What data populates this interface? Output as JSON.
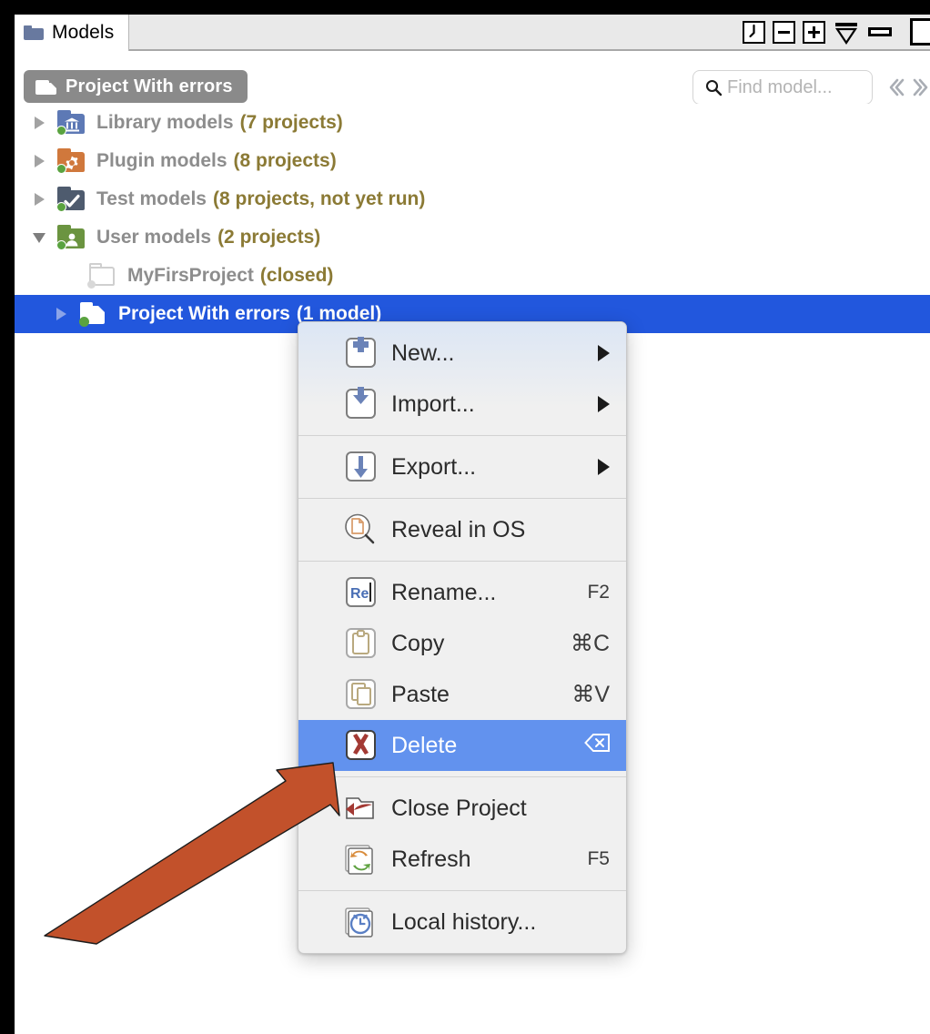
{
  "window": {
    "tab": {
      "label": "Models",
      "icon": "folder-icon"
    },
    "controls": [
      {
        "name": "clock-button",
        "icon": "clock-icon"
      },
      {
        "name": "collapse-all-button",
        "icon": "minus-box-icon"
      },
      {
        "name": "expand-all-button",
        "icon": "plus-box-icon"
      },
      {
        "name": "settings-button",
        "icon": "hourglass-icon"
      },
      {
        "name": "minimize-button",
        "icon": "minimize-icon"
      },
      {
        "name": "maximize-button",
        "icon": "maximize-icon"
      }
    ]
  },
  "toolbar": {
    "breadcrumb": {
      "label": "Project With errors",
      "icon": "folder-icon"
    },
    "search": {
      "placeholder": "Find model...",
      "value": "",
      "icon": "search-icon"
    },
    "nav_prev_icon": "chevron-left-double-icon",
    "nav_next_icon": "chevron-right-double-icon"
  },
  "tree": {
    "rows": [
      {
        "id": "library-models",
        "label": "Library models",
        "count": "(7 projects)",
        "expanded": false,
        "icon": "library-folder-icon",
        "icon_color": "#5d79b5",
        "level": 1,
        "selected": false
      },
      {
        "id": "plugin-models",
        "label": "Plugin models",
        "count": "(8 projects)",
        "expanded": false,
        "icon": "plugin-folder-icon",
        "icon_color": "#d0783c",
        "level": 1,
        "selected": false
      },
      {
        "id": "test-models",
        "label": "Test models",
        "count": "(8 projects, not yet run)",
        "expanded": false,
        "icon": "test-folder-icon",
        "icon_color": "#4e5b6e",
        "level": 1,
        "selected": false
      },
      {
        "id": "user-models",
        "label": "User models",
        "count": "(2 projects)",
        "expanded": true,
        "icon": "user-folder-icon",
        "icon_color": "#6b9440",
        "level": 1,
        "selected": false
      },
      {
        "id": "myfirsproject",
        "label": "MyFirsProject",
        "count": "(closed)",
        "expanded": null,
        "icon": "closed-folder-icon",
        "icon_color": "#cfcfcf",
        "level": 2,
        "selected": false
      },
      {
        "id": "project-with-errors",
        "label": "Project With errors",
        "count": "(1 model)",
        "expanded": false,
        "icon": "open-project-folder-icon",
        "icon_color": "#ffffff",
        "level": 2,
        "selected": true
      }
    ]
  },
  "context_menu": {
    "groups": [
      {
        "items": [
          {
            "id": "new",
            "label": "New...",
            "icon": "new-plus-icon",
            "accel": "",
            "submenu": true,
            "highlighted": false
          },
          {
            "id": "import",
            "label": "Import...",
            "icon": "import-down-arrow-icon",
            "accel": "",
            "submenu": true,
            "highlighted": false
          }
        ]
      },
      {
        "items": [
          {
            "id": "export",
            "label": "Export...",
            "icon": "export-down-arrow-icon",
            "accel": "",
            "submenu": true,
            "highlighted": false
          }
        ]
      },
      {
        "items": [
          {
            "id": "reveal-in-os",
            "label": "Reveal in OS",
            "icon": "reveal-magnifier-icon",
            "accel": "",
            "submenu": false,
            "highlighted": false
          }
        ]
      },
      {
        "items": [
          {
            "id": "rename",
            "label": "Rename...",
            "icon": "rename-re-icon",
            "accel": "F2",
            "submenu": false,
            "highlighted": false
          },
          {
            "id": "copy",
            "label": "Copy",
            "icon": "clipboard-copy-icon",
            "accel": "⌘C",
            "submenu": false,
            "highlighted": false
          },
          {
            "id": "paste",
            "label": "Paste",
            "icon": "paste-pages-icon",
            "accel": "⌘V",
            "submenu": false,
            "highlighted": false
          },
          {
            "id": "delete",
            "label": "Delete",
            "icon": "delete-x-icon",
            "accel": "⌧",
            "submenu": false,
            "highlighted": true
          }
        ]
      },
      {
        "items": [
          {
            "id": "close-project",
            "label": "Close Project",
            "icon": "close-project-arrow-icon",
            "accel": "",
            "submenu": false,
            "highlighted": false
          },
          {
            "id": "refresh",
            "label": "Refresh",
            "icon": "refresh-arrows-icon",
            "accel": "F5",
            "submenu": false,
            "highlighted": false
          }
        ]
      },
      {
        "items": [
          {
            "id": "local-history",
            "label": "Local history...",
            "icon": "clock-history-icon",
            "accel": "",
            "submenu": false,
            "highlighted": false
          }
        ]
      }
    ]
  },
  "annotation": {
    "arrow": {
      "name": "callout-arrow",
      "color": "#c2512b",
      "points_to": "delete"
    }
  },
  "colors": {
    "selection_blue": "#2257dd",
    "menu_highlight_blue": "#6292ee",
    "count_text": "#8b7a35",
    "label_text": "#8d8d8d",
    "arrow": "#c2512b"
  }
}
